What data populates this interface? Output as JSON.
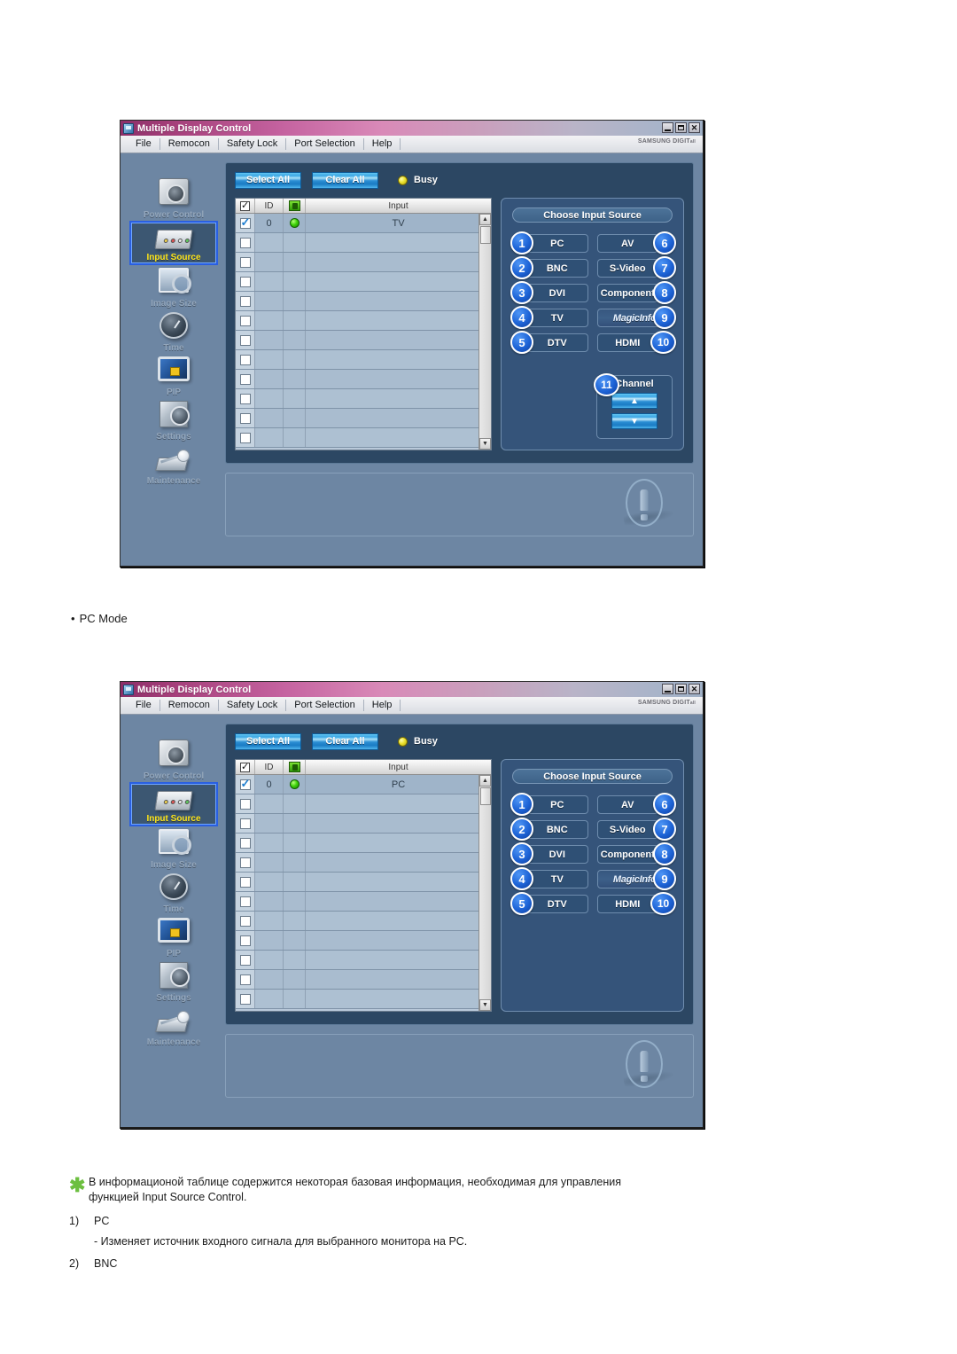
{
  "window": {
    "title": "Multiple Display Control",
    "title_icon": "app-icon",
    "controls": {
      "minimize": "minimize-icon",
      "maximize": "maximize-icon",
      "close": "✕"
    },
    "menu": [
      "File",
      "Remocon",
      "Safety Lock",
      "Port Selection",
      "Help"
    ],
    "brand": "SAMSUNG DIGIT",
    "brand_sub": "all"
  },
  "sidebar": {
    "items": [
      {
        "label": "Power Control",
        "icon": "power-control-icon",
        "active": false
      },
      {
        "label": "Input Source",
        "icon": "input-source-icon",
        "active": true
      },
      {
        "label": "Image Size",
        "icon": "image-size-icon",
        "active": false
      },
      {
        "label": "Time",
        "icon": "time-icon",
        "active": false
      },
      {
        "label": "PIP",
        "icon": "pip-icon",
        "active": false
      },
      {
        "label": "Settings",
        "icon": "settings-icon",
        "active": false
      },
      {
        "label": "Maintenance",
        "icon": "maintenance-icon",
        "active": false
      }
    ]
  },
  "toolbar": {
    "select_all": "Select All",
    "clear_all": "Clear All",
    "status_label": "Busy",
    "status_led_color": "#ece22e"
  },
  "table": {
    "headers": {
      "check": "check-all",
      "id": "ID",
      "led": "power-led",
      "input": "Input"
    },
    "rows_window1": [
      {
        "checked": true,
        "id": "0",
        "led": true,
        "input": "TV"
      },
      {
        "checked": false,
        "id": "",
        "led": false,
        "input": ""
      },
      {
        "checked": false,
        "id": "",
        "led": false,
        "input": ""
      },
      {
        "checked": false,
        "id": "",
        "led": false,
        "input": ""
      },
      {
        "checked": false,
        "id": "",
        "led": false,
        "input": ""
      },
      {
        "checked": false,
        "id": "",
        "led": false,
        "input": ""
      },
      {
        "checked": false,
        "id": "",
        "led": false,
        "input": ""
      },
      {
        "checked": false,
        "id": "",
        "led": false,
        "input": ""
      },
      {
        "checked": false,
        "id": "",
        "led": false,
        "input": ""
      },
      {
        "checked": false,
        "id": "",
        "led": false,
        "input": ""
      },
      {
        "checked": false,
        "id": "",
        "led": false,
        "input": ""
      },
      {
        "checked": false,
        "id": "",
        "led": false,
        "input": ""
      }
    ],
    "rows_window2": [
      {
        "checked": true,
        "id": "0",
        "led": true,
        "input": "PC"
      },
      {
        "checked": false,
        "id": "",
        "led": false,
        "input": ""
      },
      {
        "checked": false,
        "id": "",
        "led": false,
        "input": ""
      },
      {
        "checked": false,
        "id": "",
        "led": false,
        "input": ""
      },
      {
        "checked": false,
        "id": "",
        "led": false,
        "input": ""
      },
      {
        "checked": false,
        "id": "",
        "led": false,
        "input": ""
      },
      {
        "checked": false,
        "id": "",
        "led": false,
        "input": ""
      },
      {
        "checked": false,
        "id": "",
        "led": false,
        "input": ""
      },
      {
        "checked": false,
        "id": "",
        "led": false,
        "input": ""
      },
      {
        "checked": false,
        "id": "",
        "led": false,
        "input": ""
      },
      {
        "checked": false,
        "id": "",
        "led": false,
        "input": ""
      },
      {
        "checked": false,
        "id": "",
        "led": false,
        "input": ""
      }
    ]
  },
  "input_source": {
    "title": "Choose Input Source",
    "left_column": [
      {
        "badge": "1",
        "label": "PC"
      },
      {
        "badge": "2",
        "label": "BNC"
      },
      {
        "badge": "3",
        "label": "DVI"
      },
      {
        "badge": "4",
        "label": "TV"
      },
      {
        "badge": "5",
        "label": "DTV"
      }
    ],
    "right_column": [
      {
        "badge": "6",
        "label": "AV"
      },
      {
        "badge": "7",
        "label": "S-Video"
      },
      {
        "badge": "8",
        "label": "Component"
      },
      {
        "badge": "9",
        "label": "MagicInfo"
      },
      {
        "badge": "10",
        "label": "HDMI"
      }
    ],
    "channel": {
      "badge": "11",
      "title": "Channel",
      "up": "▲",
      "down": "▼"
    }
  },
  "captions": {
    "pc_mode": "PC Mode",
    "pc_mode_bullet": "•"
  },
  "notes": {
    "asterisk": "✱",
    "paragraph_line1": "В информационой таблице содержится некоторая базовая информация, необходимая для управления",
    "paragraph_line2": "функцией Input Source Control.",
    "item1_num": "1)",
    "item1_label": "PC",
    "item1_desc": "- Изменяет источник входного сигнала для выбранного монитора на PC.",
    "item2_num": "2)",
    "item2_label": "BNC"
  }
}
